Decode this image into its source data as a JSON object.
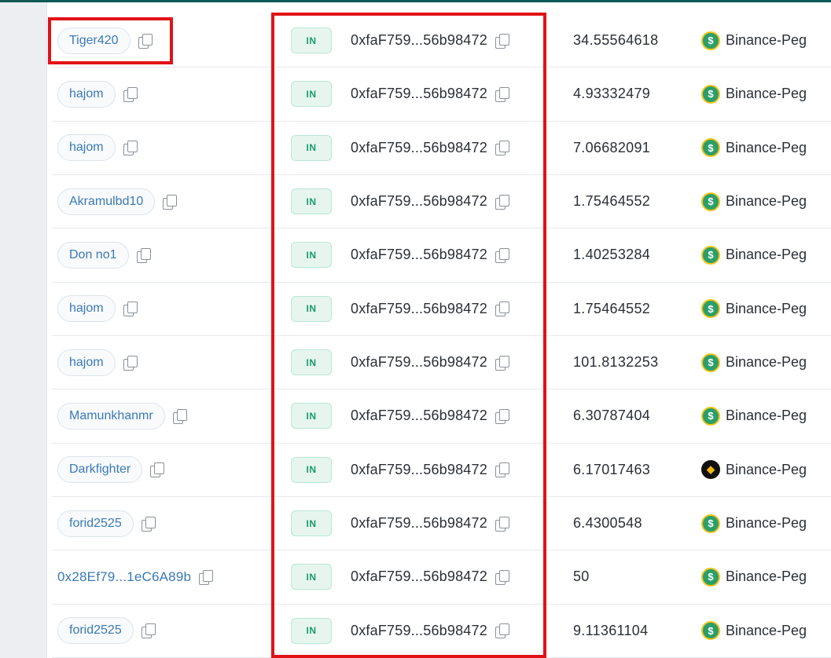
{
  "colors": {
    "link": "#3a79b8",
    "badge_text": "#1a9a6c",
    "badge_bg": "#e6f6ef",
    "highlight": "#e11216",
    "topbar": "#0c5a57"
  },
  "rows": [
    {
      "from": "Tiger420",
      "from_is_pill": true,
      "direction": "IN",
      "to": "0xfaF759...56b98472",
      "amount": "34.55564618",
      "token_icon": "dollar-coin-icon",
      "token": "Binance-Peg"
    },
    {
      "from": "hajom",
      "from_is_pill": true,
      "direction": "IN",
      "to": "0xfaF759...56b98472",
      "amount": "4.93332479",
      "token_icon": "dollar-coin-icon",
      "token": "Binance-Peg"
    },
    {
      "from": "hajom",
      "from_is_pill": true,
      "direction": "IN",
      "to": "0xfaF759...56b98472",
      "amount": "7.06682091",
      "token_icon": "dollar-coin-icon",
      "token": "Binance-Peg"
    },
    {
      "from": "Akramulbd10",
      "from_is_pill": true,
      "direction": "IN",
      "to": "0xfaF759...56b98472",
      "amount": "1.75464552",
      "token_icon": "dollar-coin-icon",
      "token": "Binance-Peg"
    },
    {
      "from": "Don no1",
      "from_is_pill": true,
      "direction": "IN",
      "to": "0xfaF759...56b98472",
      "amount": "1.40253284",
      "token_icon": "dollar-coin-icon",
      "token": "Binance-Peg"
    },
    {
      "from": "hajom",
      "from_is_pill": true,
      "direction": "IN",
      "to": "0xfaF759...56b98472",
      "amount": "1.75464552",
      "token_icon": "dollar-coin-icon",
      "token": "Binance-Peg"
    },
    {
      "from": "hajom",
      "from_is_pill": true,
      "direction": "IN",
      "to": "0xfaF759...56b98472",
      "amount": "101.8132253",
      "token_icon": "dollar-coin-icon",
      "token": "Binance-Peg"
    },
    {
      "from": "Mamunkhanmr",
      "from_is_pill": true,
      "direction": "IN",
      "to": "0xfaF759...56b98472",
      "amount": "6.30787404",
      "token_icon": "dollar-coin-icon",
      "token": "Binance-Peg"
    },
    {
      "from": "Darkfighter",
      "from_is_pill": true,
      "direction": "IN",
      "to": "0xfaF759...56b98472",
      "amount": "6.17017463",
      "token_icon": "bnb-coin-icon",
      "token": "Binance-Peg"
    },
    {
      "from": "forid2525",
      "from_is_pill": true,
      "direction": "IN",
      "to": "0xfaF759...56b98472",
      "amount": "6.4300548",
      "token_icon": "dollar-coin-icon",
      "token": "Binance-Peg"
    },
    {
      "from": "0x28Ef79...1eC6A89b",
      "from_is_pill": false,
      "direction": "IN",
      "to": "0xfaF759...56b98472",
      "amount": "50",
      "token_icon": "dollar-coin-icon",
      "token": "Binance-Peg"
    },
    {
      "from": "forid2525",
      "from_is_pill": true,
      "direction": "IN",
      "to": "0xfaF759...56b98472",
      "amount": "9.11361104",
      "token_icon": "dollar-coin-icon",
      "token": "Binance-Peg"
    }
  ]
}
